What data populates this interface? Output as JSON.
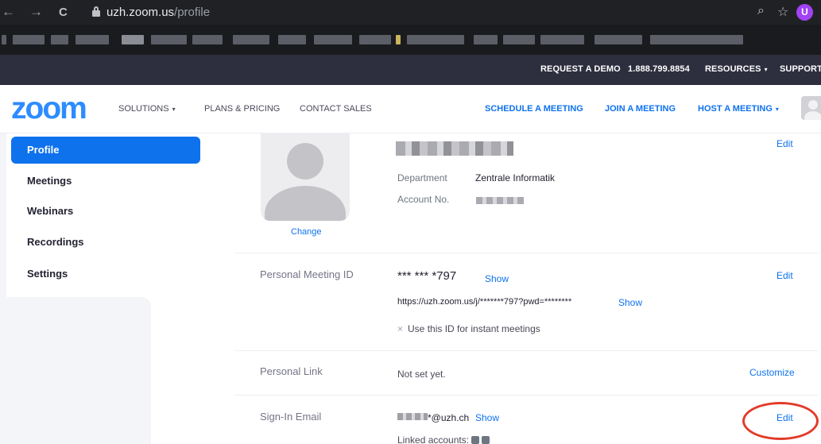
{
  "browser": {
    "back_icon": "←",
    "forward_icon": "→",
    "reload_icon": "C",
    "url_host": "uzh.zoom.us",
    "url_path": "/profile",
    "zoom_icon": "⌕",
    "star_icon": "☆",
    "profile_initial": "U"
  },
  "utility_bar": {
    "request_demo": "REQUEST A DEMO",
    "phone": "1.888.799.8854",
    "resources": "RESOURCES",
    "support": "SUPPORT"
  },
  "main_nav": {
    "logo": "zoom",
    "solutions": "SOLUTIONS",
    "plans_pricing": "PLANS & PRICING",
    "contact_sales": "CONTACT SALES",
    "schedule_meeting": "SCHEDULE A MEETING",
    "join_meeting": "JOIN A MEETING",
    "host_meeting": "HOST A MEETING",
    "caret": "▾"
  },
  "sidebar": {
    "items": [
      {
        "label": "Profile",
        "active": true
      },
      {
        "label": "Meetings",
        "active": false
      },
      {
        "label": "Webinars",
        "active": false
      },
      {
        "label": "Recordings",
        "active": false
      },
      {
        "label": "Settings",
        "active": false
      }
    ]
  },
  "profile": {
    "change_label": "Change",
    "edit_label": "Edit",
    "department_label": "Department",
    "department_value": "Zentrale Informatik",
    "account_no_label": "Account No."
  },
  "pmi": {
    "section_label": "Personal Meeting ID",
    "masked_id": "*** *** *797",
    "show_label": "Show",
    "edit_label": "Edit",
    "invite_link": "https://uzh.zoom.us/j/*******797?pwd=********",
    "invite_show_label": "Show",
    "instant_option": "Use this ID for instant meetings",
    "x_mark": "×"
  },
  "personal_link": {
    "section_label": "Personal Link",
    "value": "Not set yet.",
    "customize_label": "Customize"
  },
  "sign_in_email": {
    "section_label": "Sign-In Email",
    "email_suffix": "*@uzh.ch",
    "show_label": "Show",
    "edit_label": "Edit",
    "linked_accounts_label": "Linked accounts:"
  },
  "colors": {
    "accent": "#0e72ed",
    "logo": "#2d8cff",
    "utility_bar": "#2d2e3e",
    "highlight_circle": "#e23c2a"
  }
}
